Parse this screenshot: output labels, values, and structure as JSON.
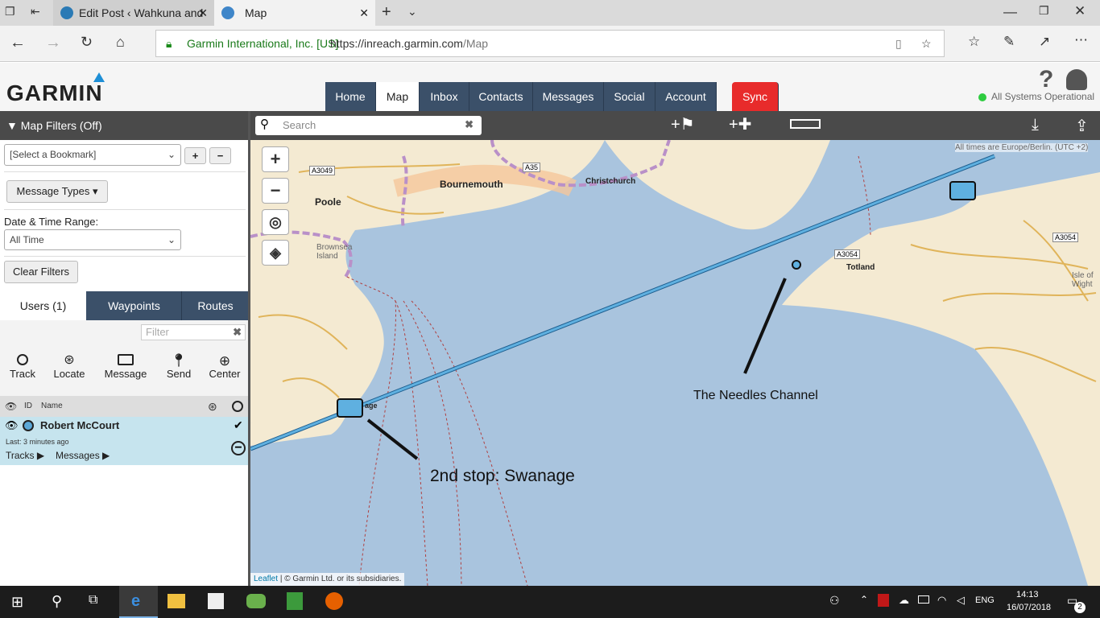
{
  "browser": {
    "tab1": "Edit Post ‹ Wahkuna and Gü",
    "tab2": "Map",
    "site_identity": "Garmin International, Inc. [US]",
    "url_host": "https://inreach.garmin.com",
    "url_path": "/Map"
  },
  "header": {
    "logo": "GARMIN",
    "nav": [
      "Home",
      "Map",
      "Inbox",
      "Contacts",
      "Messages",
      "Social",
      "Account"
    ],
    "sync": "Sync",
    "status": "All Systems Operational"
  },
  "sidebar": {
    "filters_title": "▼ Map Filters (Off)",
    "bookmark_select": "[Select a Bookmark]",
    "message_types": "Message Types",
    "date_label": "Date & Time Range:",
    "date_value": "All Time",
    "clear": "Clear Filters",
    "tabs": [
      "Users (1)",
      "Waypoints",
      "Routes"
    ],
    "filter_placeholder": "Filter",
    "actions": [
      "Track",
      "Locate",
      "Message",
      "Send",
      "Center"
    ],
    "col_id": "ID",
    "col_name": "Name",
    "user": {
      "name": "Robert McCourt",
      "last": "Last: 3 minutes ago",
      "tracks": "Tracks",
      "messages": "Messages"
    }
  },
  "map": {
    "search_placeholder": "Search",
    "timezone": "All times are Europe/Berlin. (UTC +2)",
    "attribution_link": "Leaflet",
    "attribution": "| © Garmin Ltd. or its subsidiaries.",
    "places": [
      "Poole",
      "Bournemouth",
      "Christchurch",
      "Brownsea Island",
      "Totland",
      "Isle of Wight",
      "A3049",
      "A35",
      "A3054",
      "A3054",
      "age"
    ],
    "annotations": [
      "The Needles Channel",
      "2nd stop: Swanage"
    ]
  },
  "taskbar": {
    "lang": "ENG",
    "time": "14:13",
    "date": "16/07/2018",
    "notif": "2"
  }
}
